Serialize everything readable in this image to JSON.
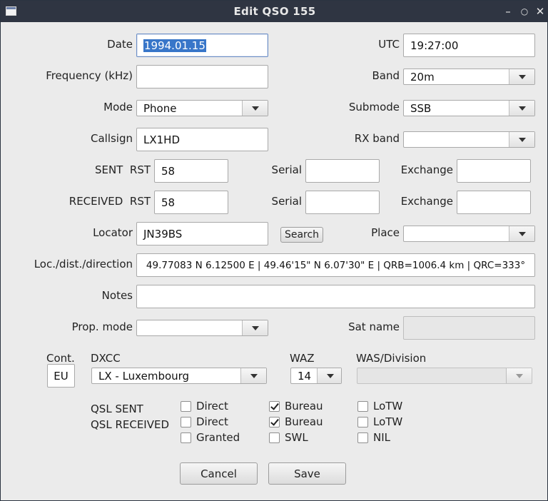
{
  "window": {
    "title": "Edit QSO 155"
  },
  "fields": {
    "date": {
      "label": "Date",
      "value": "1994.01.15"
    },
    "utc": {
      "label": "UTC",
      "value": "19:27:00"
    },
    "frequency": {
      "label": "Frequency (kHz)",
      "value": ""
    },
    "band": {
      "label": "Band",
      "value": "20m"
    },
    "mode": {
      "label": "Mode",
      "value": "Phone"
    },
    "submode": {
      "label": "Submode",
      "value": "SSB"
    },
    "callsign": {
      "label": "Callsign",
      "value": "LX1HD"
    },
    "rx_band": {
      "label": "RX band",
      "value": ""
    },
    "sent": {
      "label": "SENT",
      "rst_label": "RST",
      "rst": "58",
      "serial_label": "Serial",
      "serial": "",
      "exchange_label": "Exchange",
      "exchange": ""
    },
    "received": {
      "label": "RECEIVED",
      "rst_label": "RST",
      "rst": "58",
      "serial_label": "Serial",
      "serial": "",
      "exchange_label": "Exchange",
      "exchange": ""
    },
    "locator": {
      "label": "Locator",
      "value": "JN39BS",
      "search_label": "Search"
    },
    "place": {
      "label": "Place",
      "value": ""
    },
    "loc_dist_dir": {
      "label": "Loc./dist./direction",
      "value": "49.77083 N 6.12500 E |  49.46'15\" N   6.07'30\" E | QRB=1006.4 km | QRC=333°"
    },
    "notes": {
      "label": "Notes",
      "value": ""
    },
    "prop_mode": {
      "label": "Prop. mode",
      "value": ""
    },
    "sat_name": {
      "label": "Sat name",
      "value": ""
    }
  },
  "geo": {
    "cont_label": "Cont.",
    "cont": "EU",
    "dxcc_label": "DXCC",
    "dxcc": "LX - Luxembourg",
    "waz_label": "WAZ",
    "waz": "14",
    "was_label": "WAS/Division",
    "was": ""
  },
  "qsl": {
    "sent_label": "QSL SENT",
    "received_label": "QSL RECEIVED",
    "sent": [
      {
        "label": "Direct",
        "checked": false
      },
      {
        "label": "Bureau",
        "checked": true
      },
      {
        "label": "LoTW",
        "checked": false
      }
    ],
    "received": [
      {
        "label": "Direct",
        "checked": false
      },
      {
        "label": "Bureau",
        "checked": true
      },
      {
        "label": "LoTW",
        "checked": false
      }
    ],
    "extra": [
      {
        "label": "Granted",
        "checked": false
      },
      {
        "label": "SWL",
        "checked": false
      },
      {
        "label": "NIL",
        "checked": false
      }
    ]
  },
  "buttons": {
    "cancel": "Cancel",
    "save": "Save"
  }
}
